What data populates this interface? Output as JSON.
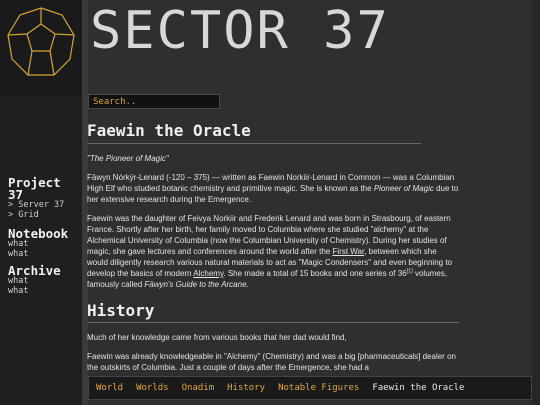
{
  "site": {
    "title": "SECTOR 37"
  },
  "search": {
    "placeholder": "Search.."
  },
  "sidebar": {
    "sections": [
      {
        "title_line1": "Project",
        "title_line2": "37",
        "links": [
          "> Server 37",
          "> Grid"
        ]
      },
      {
        "title_line1": "Notebook",
        "links": [
          "what",
          "what"
        ]
      },
      {
        "title_line1": "Archive",
        "links": [
          "what",
          "what"
        ]
      }
    ]
  },
  "article": {
    "title": "Faewin the Oracle",
    "epithet": "\"The Pioneer of Magic\"",
    "intro": {
      "a": "Fāwyn Nórkýr-Lenard (-120 – 375) — written as Faewin Norkiir-Lenard in Common — was a Columbian High Elf who studied botanic chemistry and primitive magic. She is known as the ",
      "em": "Pioneer of Magic",
      "b": " due to her extensive research during the Emergence."
    },
    "bio": {
      "a": "Faewin was the daughter of Feivya Norkiir and Frederik Lenard and was born in Strasbourg, of eastern France. Shortly after her birth, her family moved to Columbia where she studied \"alchemy\" at the Alchemical University of Columbia (now the Columbian University of Chemistry). During her studies of magic, she gave lectures and conferences around the world after the ",
      "link1": "First War",
      "b": ", between which she would diligently research various natural materials to act as \"Magic Condensers\" and even beginning to develop the basics of modern ",
      "link2": "Alchemy",
      "c": ". She made a total of 15 books and one series of 36",
      "sup": "[1]",
      "d": " volumes, famously called ",
      "em": "Fāwyn's Guide to the Arcane",
      "e": "."
    },
    "history_title": "History",
    "history_p1": "Much of her knowledge came from various books that her dad would find,",
    "history_p2": "Faewin was already knowledgeable in \"Alchemy\" (Chemistry) and was a big [pharmaceuticals] dealer on the outskirts of Columbia. Just a couple of days after the Emergence, she had a"
  },
  "breadcrumbs": {
    "items": [
      "World",
      "Worlds",
      "Onadim",
      "History",
      "Notable Figures"
    ],
    "current": "Faewin the Oracle"
  },
  "colors": {
    "accent": "#e0a83c",
    "background": "#2f2f2f",
    "sidebar": "#1f1f1f"
  }
}
